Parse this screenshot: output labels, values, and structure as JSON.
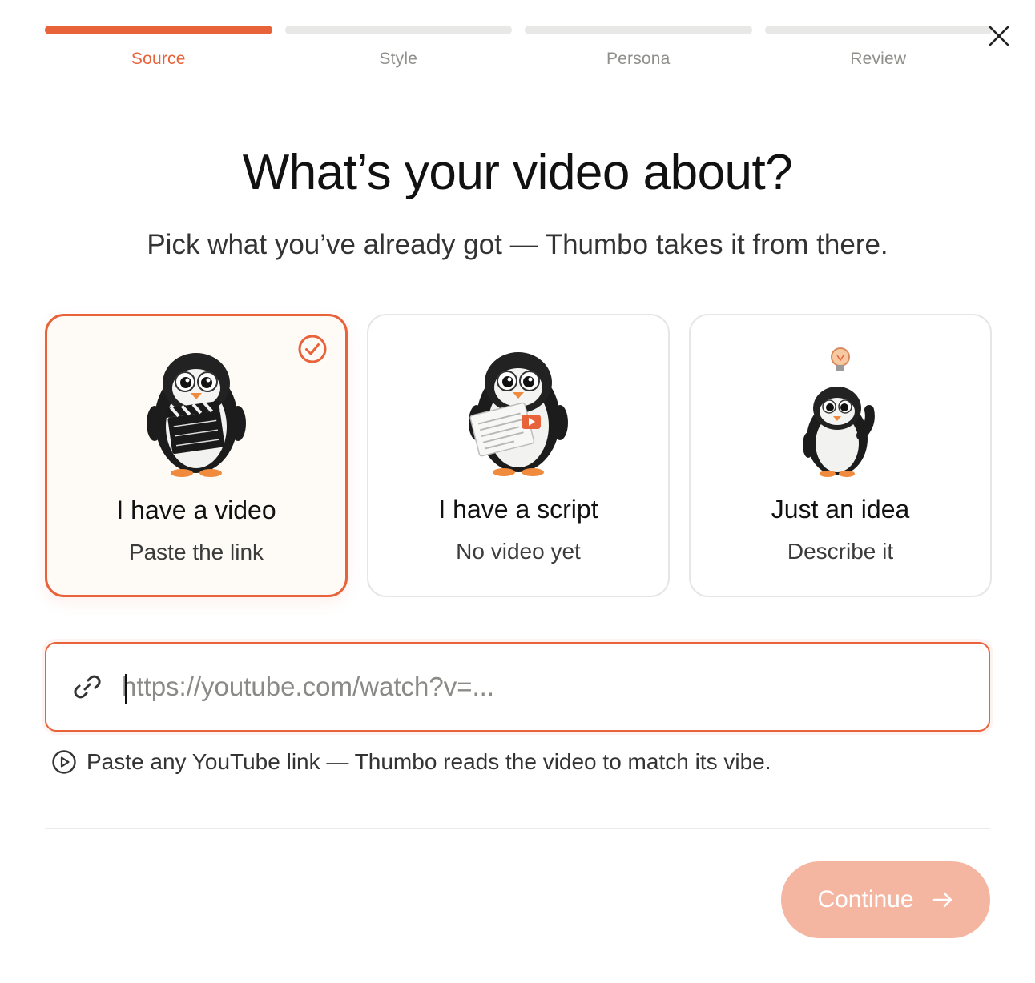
{
  "stepper": {
    "steps": [
      {
        "label": "Source",
        "active": true
      },
      {
        "label": "Style",
        "active": false
      },
      {
        "label": "Persona",
        "active": false
      },
      {
        "label": "Review",
        "active": false
      }
    ]
  },
  "close_icon": "close-icon",
  "heading": {
    "title": "What’s your video about?",
    "subtitle": "Pick what you’ve already got — Thumbo takes it from there."
  },
  "cards": [
    {
      "title": "I have a video",
      "subtitle": "Paste the link",
      "selected": true,
      "icon": "penguin-clapperboard"
    },
    {
      "title": "I have a script",
      "subtitle": "No video yet",
      "selected": false,
      "icon": "penguin-script"
    },
    {
      "title": "Just an idea",
      "subtitle": "Describe it",
      "selected": false,
      "icon": "penguin-lightbulb"
    }
  ],
  "url_input": {
    "value": "",
    "placeholder": "https://youtube.com/watch?v=..."
  },
  "hint": {
    "text": "Paste any YouTube link — Thumbo reads the video to match its vibe."
  },
  "footer": {
    "continue_label": "Continue"
  },
  "colors": {
    "accent": "#e8623a",
    "accent_disabled": "#f5b6a1",
    "inactive_step": "#e8e8e6"
  }
}
